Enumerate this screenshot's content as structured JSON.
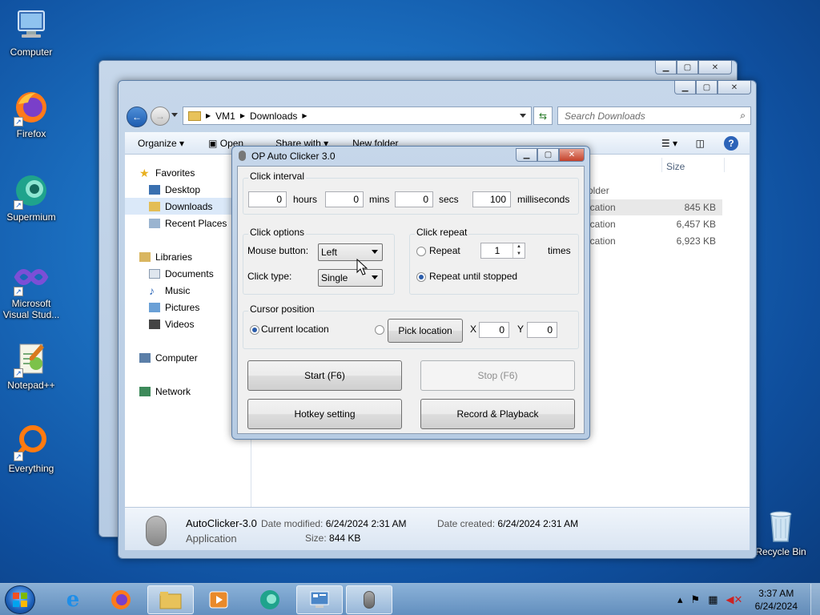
{
  "desktop": {
    "icons": [
      {
        "label": "Computer",
        "icon": "computer-icon"
      },
      {
        "label": "Firefox",
        "icon": "firefox-icon"
      },
      {
        "label": "Supermium",
        "icon": "supermium-icon"
      },
      {
        "label": "Microsoft Visual Stud...",
        "icon": "visual-studio-icon"
      },
      {
        "label": "Notepad++",
        "icon": "notepadpp-icon"
      },
      {
        "label": "Everything",
        "icon": "everything-icon"
      }
    ],
    "recycle_bin": "Recycle Bin"
  },
  "explorer": {
    "breadcrumb": [
      "VM1",
      "Downloads"
    ],
    "search_placeholder": "Search Downloads",
    "toolbar": {
      "organize": "Organize",
      "open": "Open",
      "share_with": "Share with",
      "new_folder": "New folder"
    },
    "nav": {
      "favorites": "Favorites",
      "favorites_items": [
        "Desktop",
        "Downloads",
        "Recent Places"
      ],
      "libraries": "Libraries",
      "libraries_items": [
        "Documents",
        "Music",
        "Pictures",
        "Videos"
      ],
      "computer": "Computer",
      "network": "Network"
    },
    "columns": {
      "size": "Size"
    },
    "rows": [
      {
        "type": "older",
        "size": ""
      },
      {
        "type": "ication",
        "size": "845 KB"
      },
      {
        "type": "ication",
        "size": "6,457 KB"
      },
      {
        "type": "ication",
        "size": "6,923 KB"
      }
    ],
    "details": {
      "name": "AutoClicker-3.0",
      "type": "Application",
      "modified_label": "Date modified:",
      "modified": "6/24/2024 2:31 AM",
      "created_label": "Date created:",
      "created": "6/24/2024 2:31 AM",
      "size_label": "Size:",
      "size": "844 KB"
    }
  },
  "autoclicker": {
    "title": "OP Auto Clicker 3.0",
    "click_interval": {
      "title": "Click interval",
      "hours": "0",
      "hours_label": "hours",
      "mins": "0",
      "mins_label": "mins",
      "secs": "0",
      "secs_label": "secs",
      "ms": "100",
      "ms_label": "milliseconds"
    },
    "click_options": {
      "title": "Click options",
      "mouse_button_label": "Mouse button:",
      "mouse_button": "Left",
      "click_type_label": "Click type:",
      "click_type": "Single"
    },
    "click_repeat": {
      "title": "Click repeat",
      "repeat_label": "Repeat",
      "repeat_count": "1",
      "times_label": "times",
      "until_stopped_label": "Repeat until stopped"
    },
    "cursor_position": {
      "title": "Cursor position",
      "current_label": "Current location",
      "pick_label": "Pick location",
      "x_label": "X",
      "x": "0",
      "y_label": "Y",
      "y": "0"
    },
    "buttons": {
      "start": "Start (F6)",
      "stop": "Stop (F6)",
      "hotkey": "Hotkey setting",
      "record": "Record & Playback"
    }
  },
  "taskbar": {
    "time": "3:37 AM",
    "date": "6/24/2024"
  }
}
